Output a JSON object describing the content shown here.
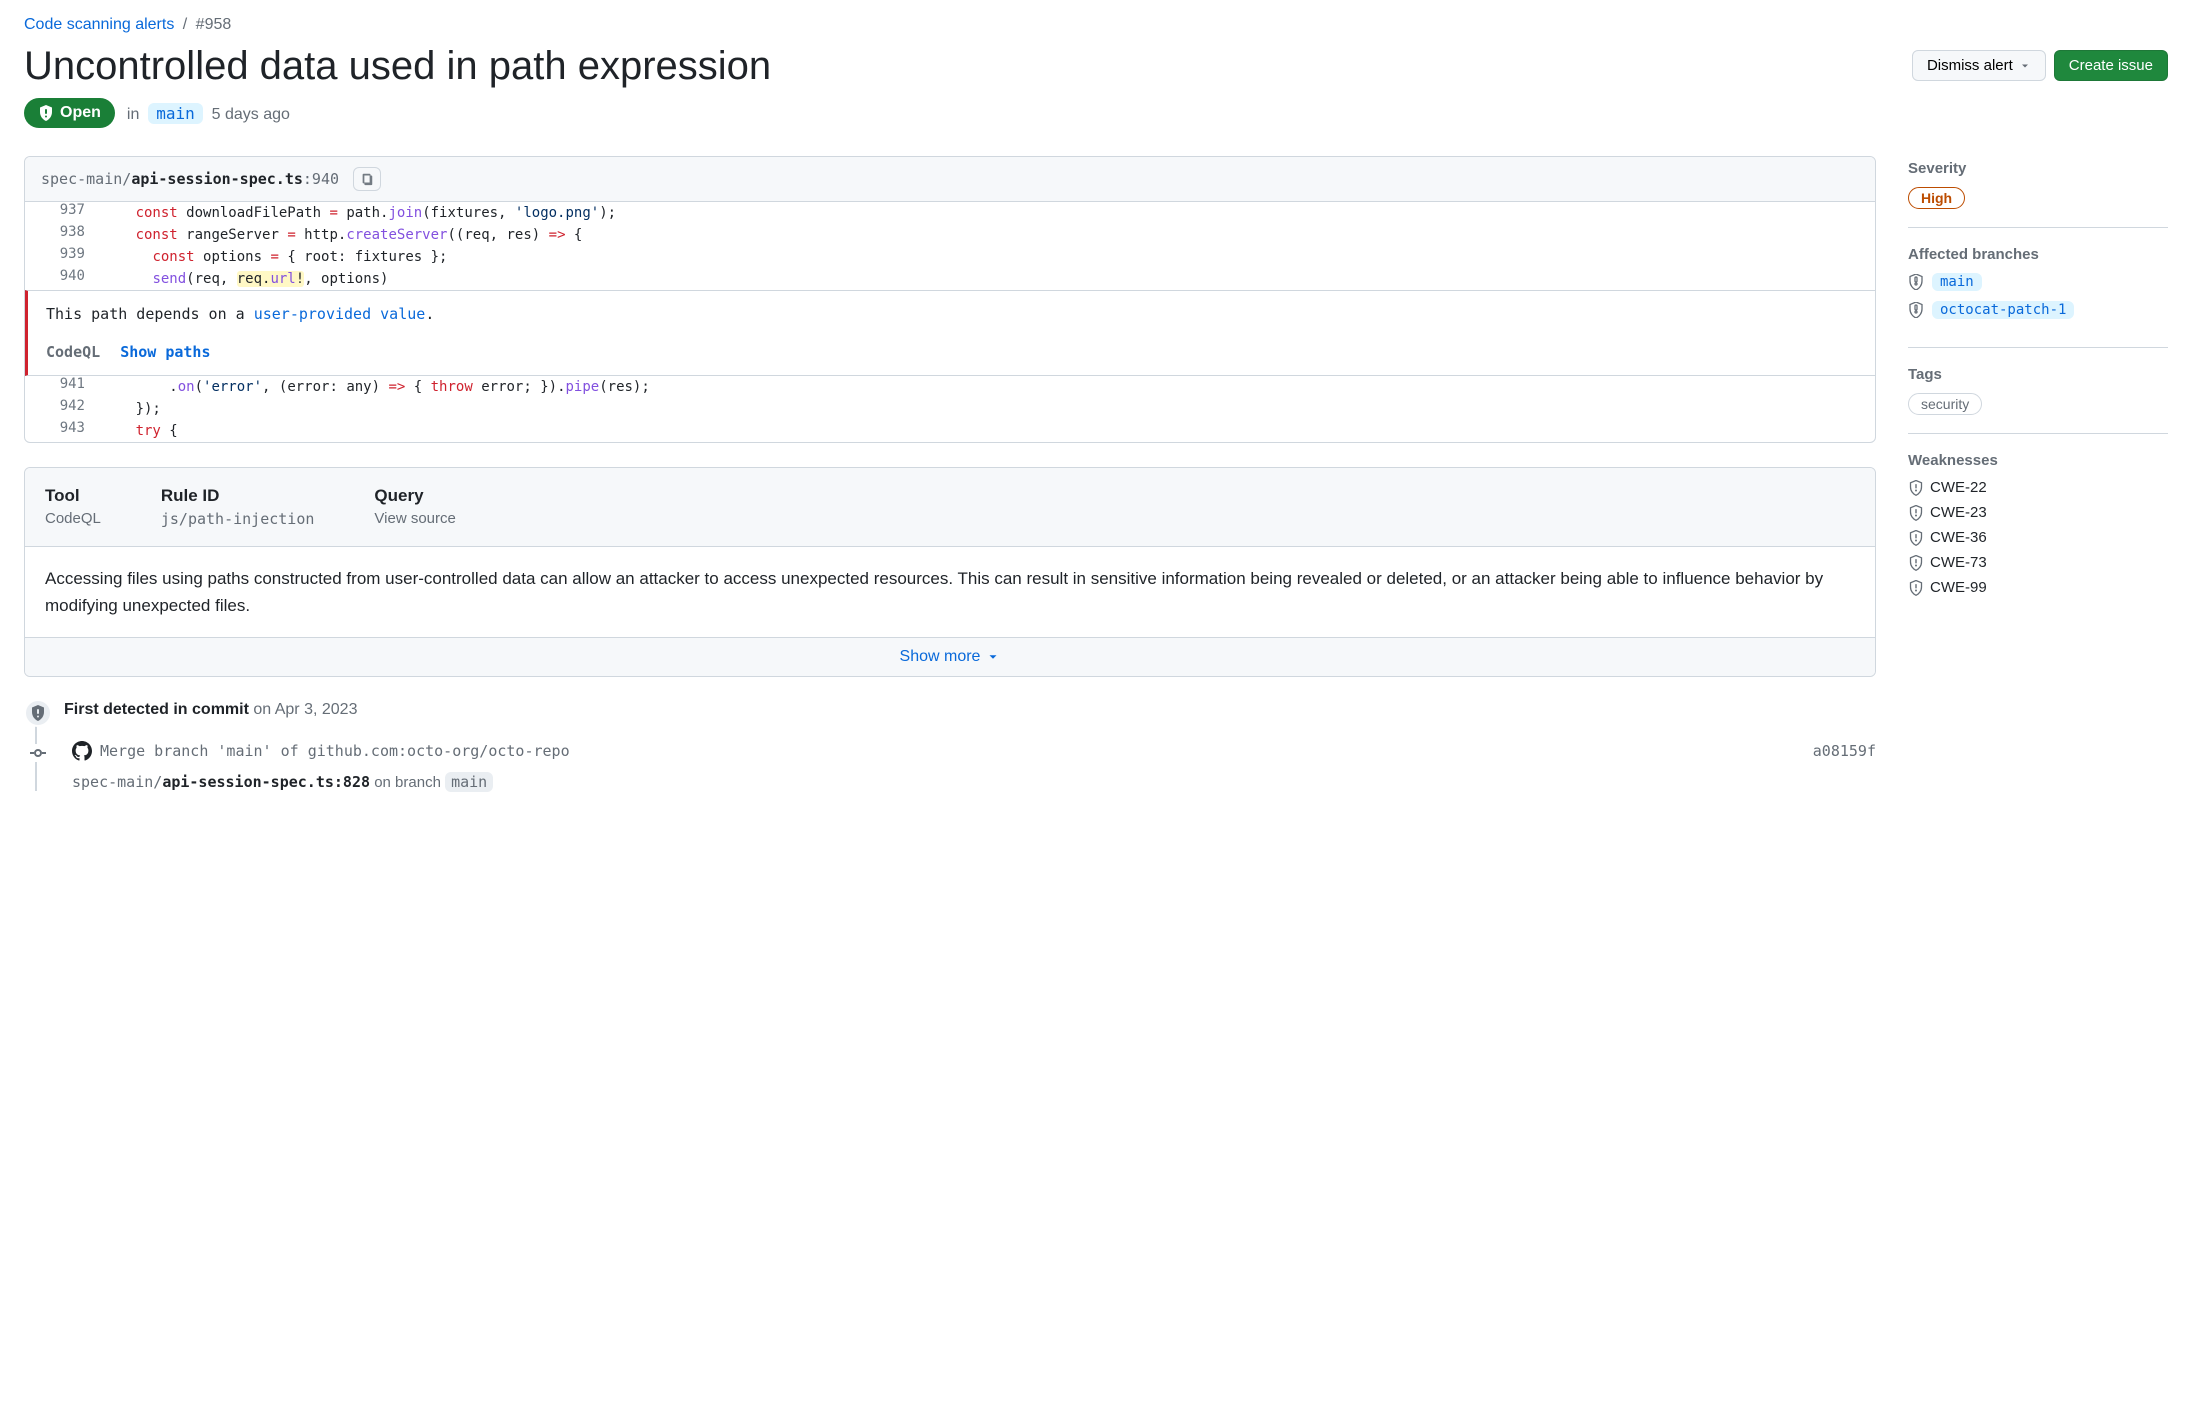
{
  "breadcrumb": {
    "parent": "Code scanning alerts",
    "id": "#958"
  },
  "title": "Uncontrolled data used in path expression",
  "header_buttons": {
    "dismiss": "Dismiss alert",
    "create_issue": "Create issue"
  },
  "state": {
    "label": "Open",
    "in_prefix": "in",
    "branch": "main",
    "age": "5 days ago"
  },
  "code": {
    "path_dir": "spec-main/",
    "path_file": "api-session-spec.ts",
    "path_line": ":940",
    "explanation_pre": "This path depends on a ",
    "explanation_link": "user-provided value",
    "explanation_post": ".",
    "tool": "CodeQL",
    "show_paths": "Show paths"
  },
  "details": {
    "tool_label": "Tool",
    "tool_value": "CodeQL",
    "rule_label": "Rule ID",
    "rule_value": "js/path-injection",
    "query_label": "Query",
    "query_value": "View source",
    "body": "Accessing files using paths constructed from user-controlled data can allow an attacker to access unexpected resources. This can result in sensitive information being revealed or deleted, or an attacker being able to influence behavior by modifying unexpected files.",
    "show_more": "Show more"
  },
  "timeline": {
    "first_detected_label": "First detected in commit",
    "first_detected_date": "on Apr 3, 2023",
    "commit_msg": "Merge branch 'main' of github.com:octo-org/octo-repo",
    "commit_sha": "a08159f",
    "file_dir": "spec-main/",
    "file_name": "api-session-spec.ts:828",
    "on_branch_label": " on branch ",
    "file_branch": "main"
  },
  "sidebar": {
    "severity_label": "Severity",
    "severity_value": "High",
    "branches_label": "Affected branches",
    "branches": [
      "main",
      "octocat-patch-1"
    ],
    "tags_label": "Tags",
    "tags": [
      "security"
    ],
    "weaknesses_label": "Weaknesses",
    "weaknesses": [
      "CWE-22",
      "CWE-23",
      "CWE-36",
      "CWE-73",
      "CWE-99"
    ]
  }
}
